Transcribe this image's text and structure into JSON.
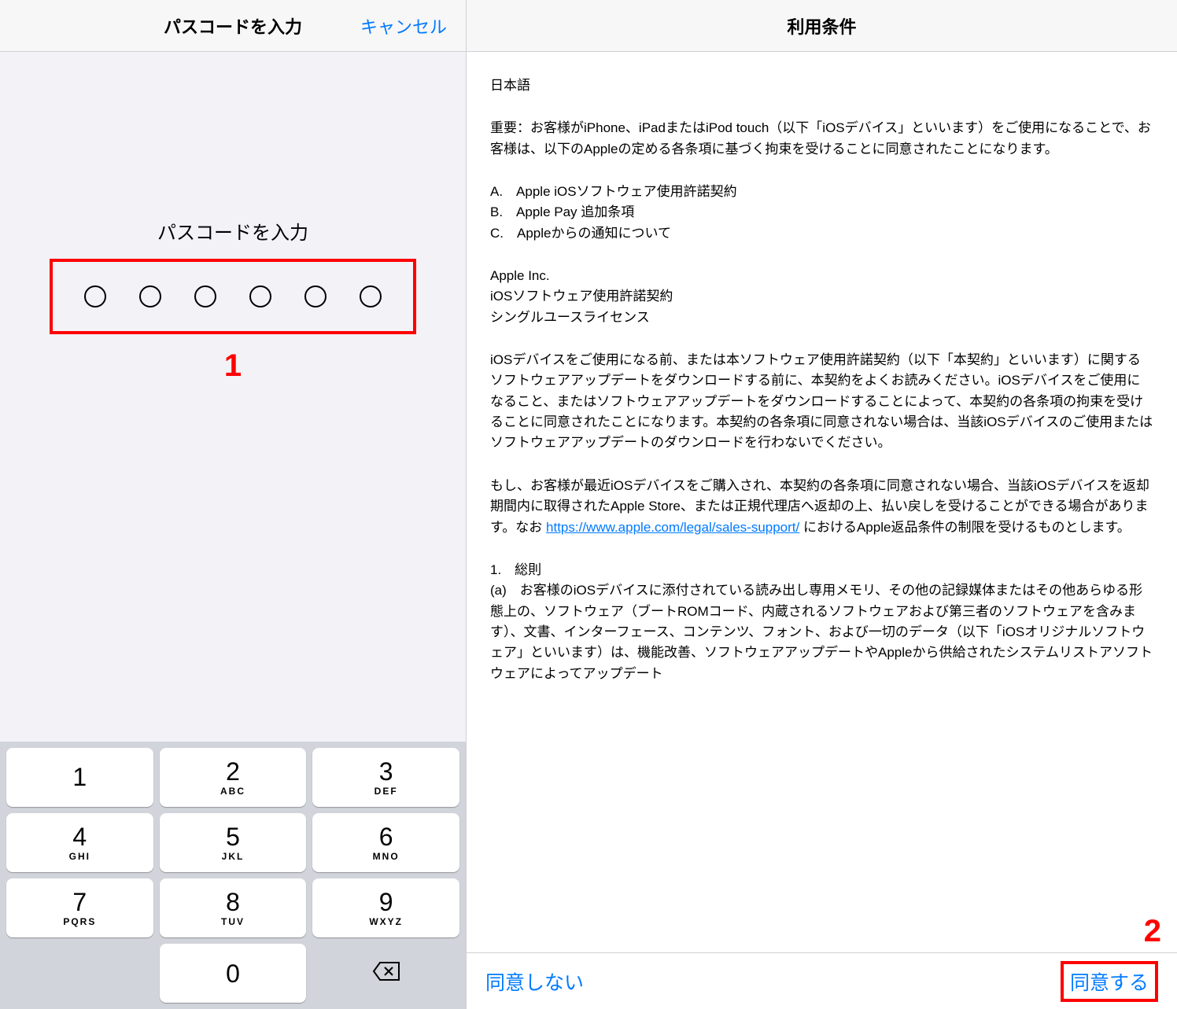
{
  "left": {
    "title": "パスコードを入力",
    "cancel": "キャンセル",
    "prompt": "パスコードを入力",
    "annotation": "1"
  },
  "keypad": {
    "keys": [
      {
        "num": "1",
        "letters": ""
      },
      {
        "num": "2",
        "letters": "ABC"
      },
      {
        "num": "3",
        "letters": "DEF"
      },
      {
        "num": "4",
        "letters": "GHI"
      },
      {
        "num": "5",
        "letters": "JKL"
      },
      {
        "num": "6",
        "letters": "MNO"
      },
      {
        "num": "7",
        "letters": "PQRS"
      },
      {
        "num": "8",
        "letters": "TUV"
      },
      {
        "num": "9",
        "letters": "WXYZ"
      },
      {
        "num": "0",
        "letters": ""
      }
    ]
  },
  "right": {
    "title": "利用条件",
    "lang": "日本語",
    "important": "重要：お客様がiPhone、iPadまたはiPod touch（以下「iOSデバイス」といいます）をご使用になることで、お客様は、以下のAppleの定める各条項に基づく拘束を受けることに同意されたことになります。",
    "listA": "A.　Apple iOSソフトウェア使用許諾契約",
    "listB": "B.　Apple Pay 追加条項",
    "listC": "C.　Appleからの通知について",
    "company1": "Apple Inc.",
    "company2": "iOSソフトウェア使用許諾契約",
    "company3": "シングルユースライセンス",
    "para1": "iOSデバイスをご使用になる前、または本ソフトウェア使用許諾契約（以下「本契約」といいます）に関するソフトウェアアップデートをダウンロードする前に、本契約をよくお読みください。iOSデバイスをご使用になること、またはソフトウェアアップデートをダウンロードすることによって、本契約の各条項の拘束を受けることに同意されたことになります。本契約の各条項に同意されない場合は、当該iOSデバイスのご使用またはソフトウェアアップデートのダウンロードを行わないでください。",
    "para2a": "もし、お客様が最近iOSデバイスをご購入され、本契約の各条項に同意されない場合、当該iOSデバイスを返却期間内に取得されたApple Store、または正規代理店へ返却の上、払い戻しを受けることができる場合があります。なお ",
    "para2link": "https://www.apple.com/legal/sales-support/",
    "para2b": " におけるApple返品条件の制限を受けるものとします。",
    "section1_title": "1.　総則",
    "section1_body": "(a)　お客様のiOSデバイスに添付されている読み出し専用メモリ、その他の記録媒体またはその他あらゆる形態上の、ソフトウェア（ブートROMコード、内蔵されるソフトウェアおよび第三者のソフトウェアを含みます）、文書、インターフェース、コンテンツ、フォント、および一切のデータ（以下「iOSオリジナルソフトウェア」といいます）は、機能改善、ソフトウェアアップデートやAppleから供給されたシステムリストアソフトウェアによってアップデート",
    "disagree": "同意しない",
    "agree": "同意する",
    "annotation": "2"
  }
}
